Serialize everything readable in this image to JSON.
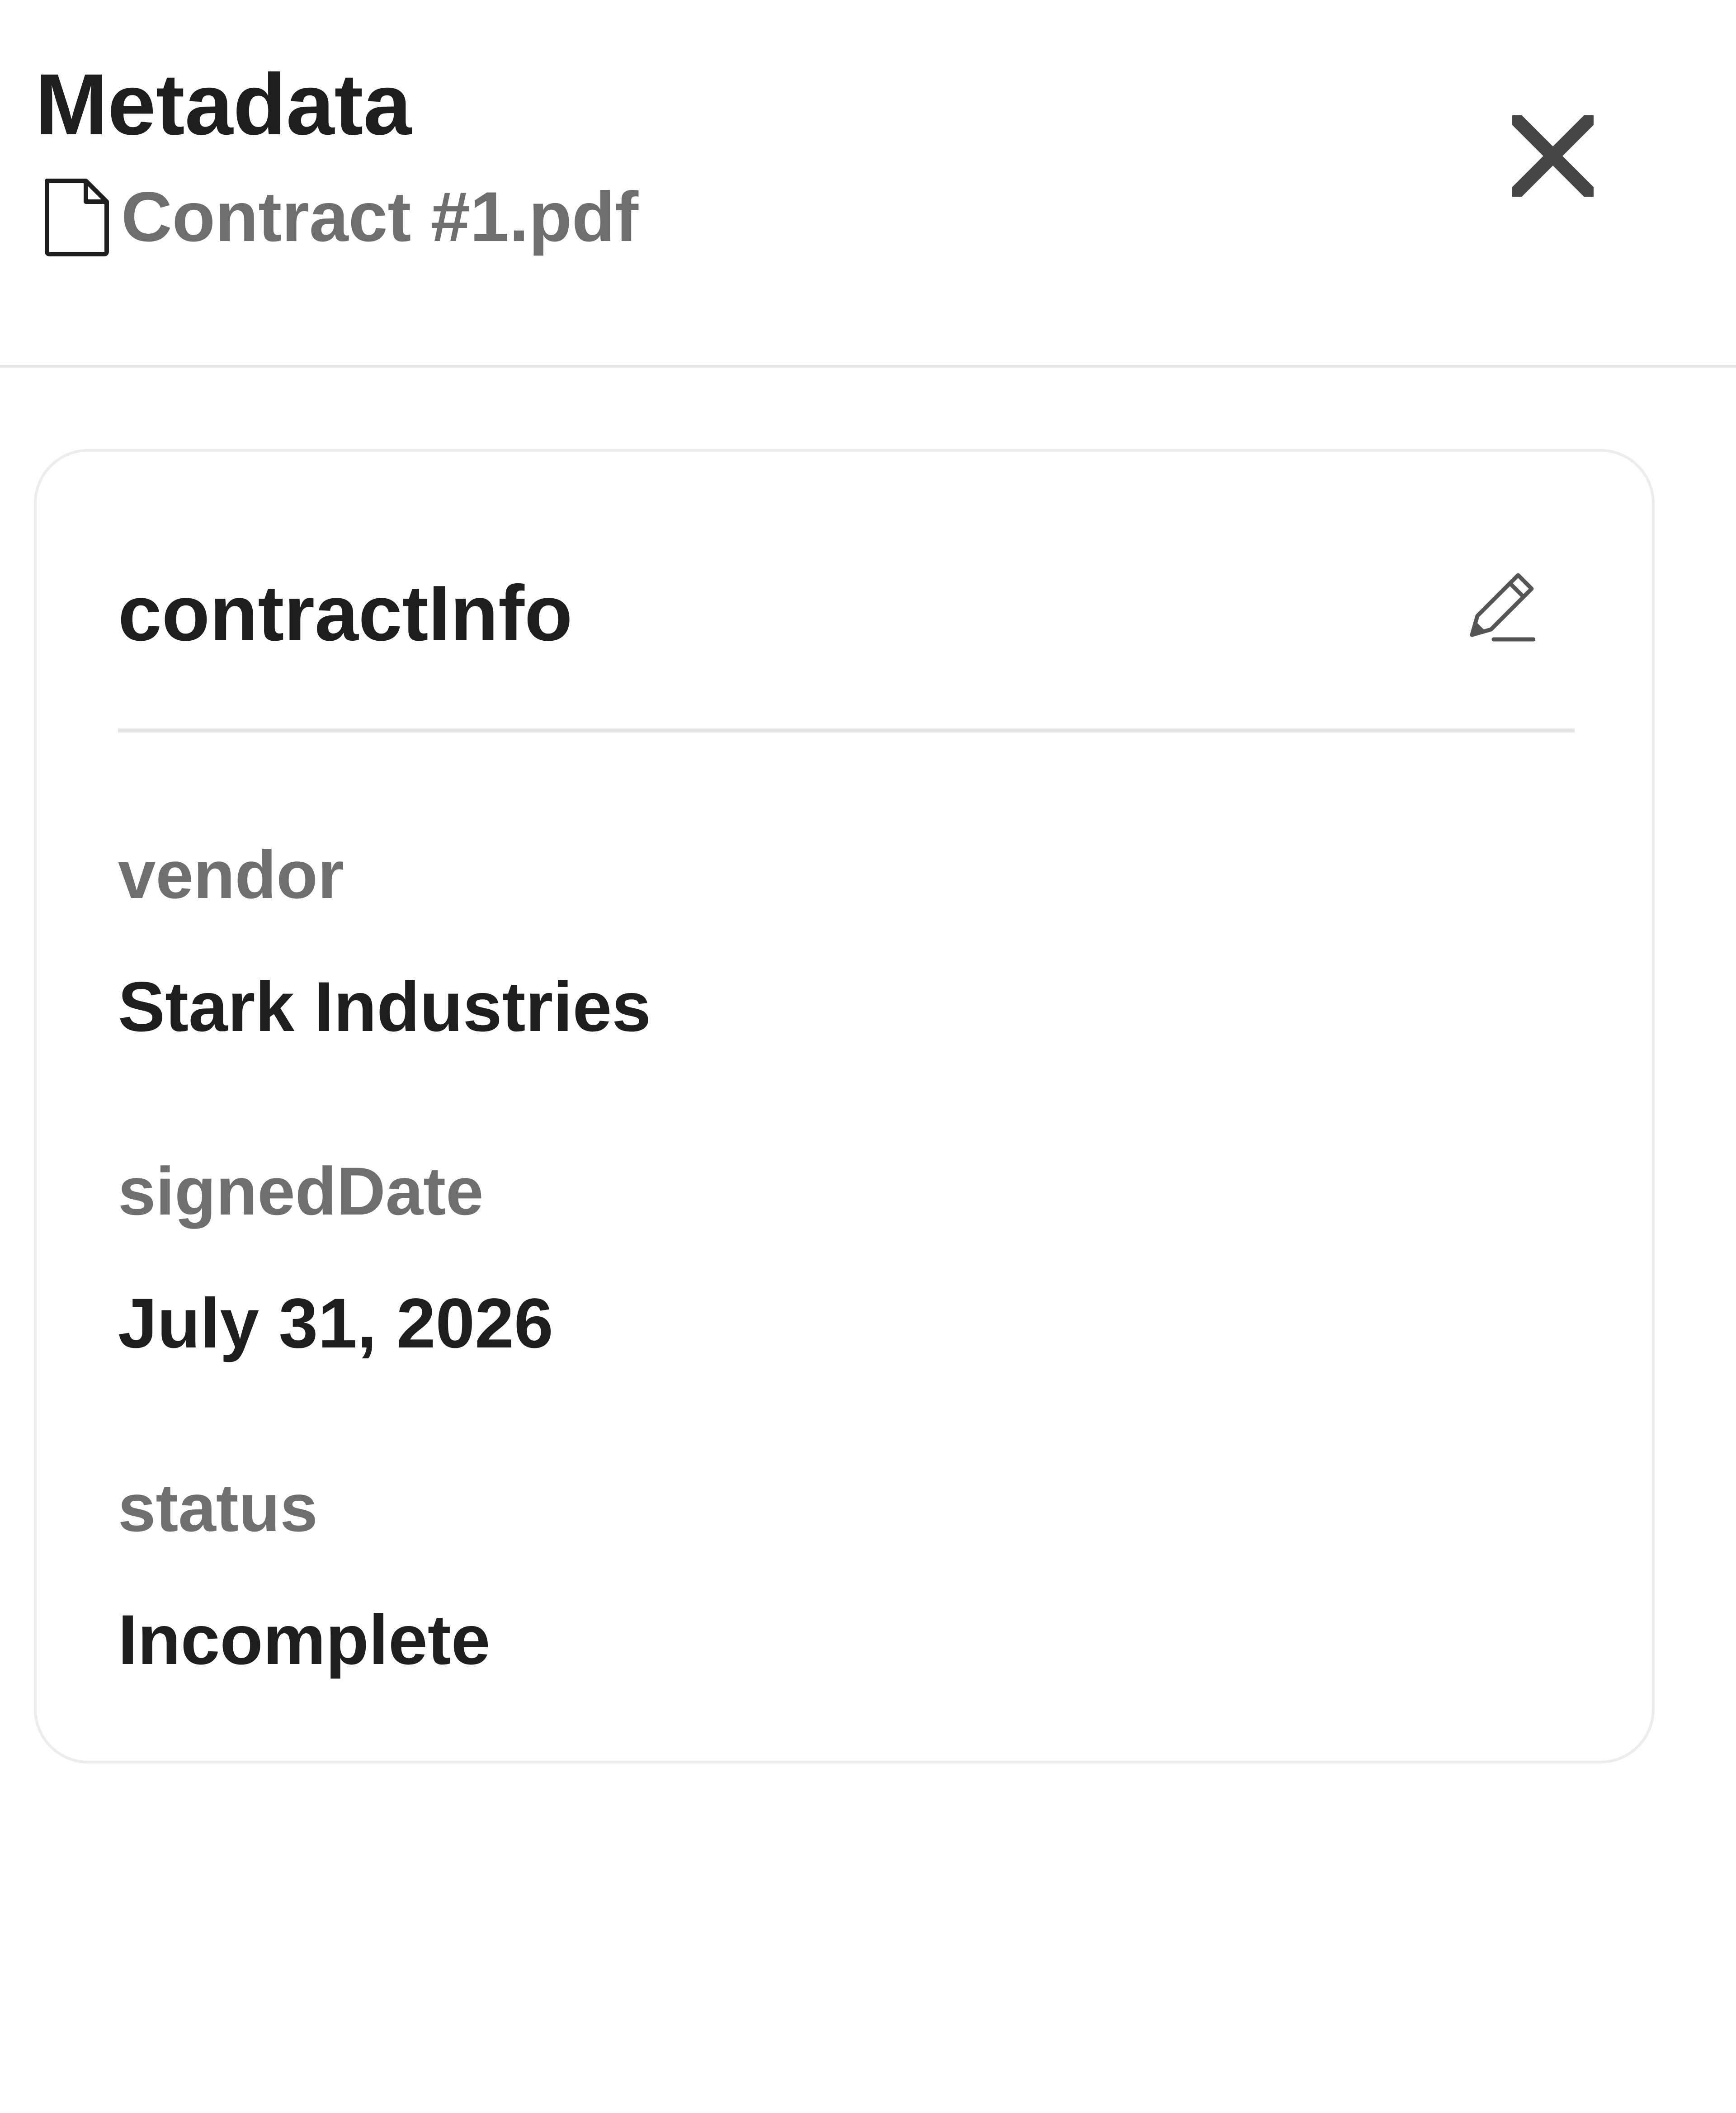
{
  "header": {
    "title": "Metadata",
    "file_name": "Contract #1.pdf",
    "file_icon": "document-icon",
    "close_icon": "close-icon"
  },
  "card": {
    "title": "contractInfo",
    "edit_icon": "pencil-icon",
    "fields": [
      {
        "label": "vendor",
        "value": "Stark Industries"
      },
      {
        "label": "signedDate",
        "value": "July 31, 2026"
      },
      {
        "label": "status",
        "value": "Incomplete"
      }
    ]
  },
  "colors": {
    "text_primary": "#1e1e1e",
    "text_secondary": "#6e6e6e",
    "border": "#ececec"
  }
}
